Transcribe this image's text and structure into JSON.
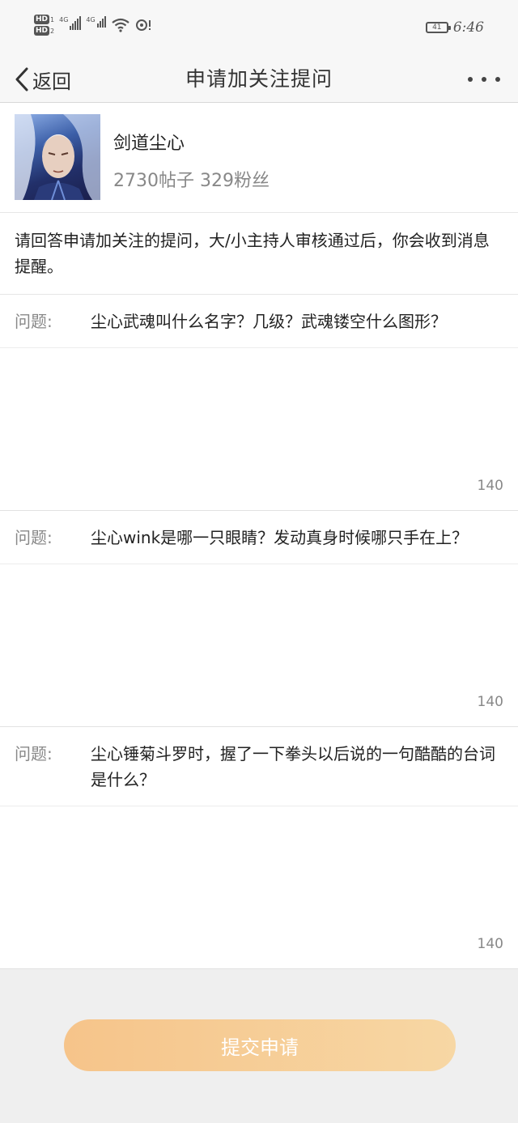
{
  "status_bar": {
    "sim1_badge": "HD",
    "sim1_num": "1",
    "sim2_badge": "HD",
    "sim2_num": "2",
    "net1": "4G",
    "net2": "4G",
    "battery": "41",
    "time": "6:46"
  },
  "nav": {
    "back_label": "返回",
    "title": "申请加关注提问"
  },
  "profile": {
    "name": "剑道尘心",
    "stats": "2730帖子 329粉丝"
  },
  "notice": "请回答申请加关注的提问，大/小主持人审核通过后，你会收到消息提醒。",
  "questions": [
    {
      "label": "问题:",
      "text": "尘心武魂叫什么名字？几级？武魂镂空什么图形？",
      "answer": "",
      "count": "140"
    },
    {
      "label": "问题:",
      "text": "尘心wink是哪一只眼睛？发动真身时候哪只手在上？",
      "answer": "",
      "count": "140"
    },
    {
      "label": "问题:",
      "text": "尘心锤菊斗罗时，握了一下拳头以后说的一句酷酷的台词是什么？",
      "answer": "",
      "count": "140"
    }
  ],
  "submit_label": "提交申请",
  "colors": {
    "submit_start": "#f6c48a",
    "submit_end": "#f7d7a4",
    "page_bg": "#efefef"
  }
}
